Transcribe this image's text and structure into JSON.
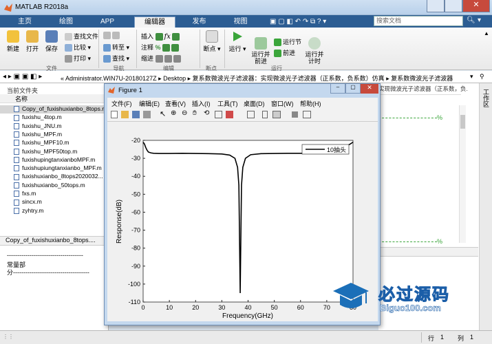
{
  "window": {
    "title": "MATLAB R2018a"
  },
  "tabs": [
    "主页",
    "绘图",
    "APP",
    "编辑器",
    "发布",
    "视图"
  ],
  "search_placeholder": "搜索文档",
  "ribbon": {
    "file": {
      "new": "新建",
      "open": "打开",
      "save": "保存",
      "find_files": "查找文件",
      "compare": "比较",
      "print": "打印",
      "group": "文件"
    },
    "nav": {
      "goto": "转至",
      "find": "查找",
      "group": "导航"
    },
    "edit": {
      "insert": "插入",
      "comment": "注释",
      "indent": "缩进",
      "group": "编辑"
    },
    "breakpoints": {
      "label": "断点",
      "group": "断点"
    },
    "run": {
      "run": "运行",
      "run_advance": "运行并\n前进",
      "run_section": "运行节",
      "advance": "前进",
      "run_time": "运行并\n计时",
      "group": "运行"
    }
  },
  "address": {
    "path": [
      "Administrator.WIN7U-20180127Z",
      "Desktop",
      "复系数微波光子滤波器：实现微波光子滤波器（正系数，负系数）仿真",
      "复系数微波光子滤波器"
    ]
  },
  "current_folder": {
    "title": "当前文件夹",
    "column": "名称",
    "files": [
      "Copy_of_fuxishuxianbo_8tops.m",
      "fuxishu_4top.m",
      "fuxishu_JNU.m",
      "fuxishu_MPF.m",
      "fuxishu_MPF10.m",
      "fuxishu_MPF50top.m",
      "fuxishupingtanxianboMPF.m",
      "fuxishupiungtanxianbo_MPF.m",
      "fuxishuxianbo_8tops2020032...",
      "fuxishuxianbo_50tops.m",
      "fxs.m",
      "sincx.m",
      "zyhtry.m"
    ],
    "details_title": "Copy_of_fuxishuxianbo_8tops....",
    "details_lines": [
      "-------------------------------------",
      "常量部",
      "分-------------------------------------"
    ]
  },
  "editor_right": {
    "header": "实现微波光子滤波器（正系数，负...",
    "marker": "%"
  },
  "side_tab": "工作区",
  "figure": {
    "title": "Figure 1",
    "menu": [
      "文件(F)",
      "编辑(E)",
      "查看(V)",
      "插入(I)",
      "工具(T)",
      "桌面(D)",
      "窗口(W)",
      "帮助(H)"
    ]
  },
  "chart_data": {
    "type": "line",
    "xlabel": "Frequency(GHz)",
    "ylabel": "Response(dB)",
    "xlim": [
      0,
      80
    ],
    "ylim": [
      -110,
      -20
    ],
    "xticks": [
      0,
      10,
      20,
      30,
      40,
      50,
      60,
      70,
      80
    ],
    "yticks": [
      -20,
      -30,
      -40,
      -50,
      -60,
      -70,
      -80,
      -90,
      -100,
      -110
    ],
    "series": [
      {
        "name": "10抽头",
        "color": "#000000",
        "x": [
          0,
          0.5,
          1,
          1.5,
          2,
          3,
          4,
          6,
          10,
          15,
          20,
          25,
          30,
          33,
          35,
          36,
          36.5,
          37,
          37.5,
          38,
          39,
          41,
          45,
          50,
          55,
          60,
          65,
          70,
          75,
          79,
          80
        ],
        "y": [
          -21,
          -22,
          -24,
          -25.5,
          -26.5,
          -27,
          -27.2,
          -27.3,
          -27.3,
          -27.2,
          -27.3,
          -27.4,
          -27.6,
          -28.2,
          -30,
          -35,
          -45,
          -105,
          -45,
          -35,
          -30,
          -28,
          -27.4,
          -27.3,
          -27.2,
          -27.2,
          -27.1,
          -26.5,
          -25,
          -22,
          -21
        ]
      }
    ],
    "legend": "top-right",
    "grid": false
  },
  "status": {
    "row_label": "行",
    "row": "1",
    "col_label": "列",
    "col": "1"
  },
  "watermark": {
    "title": "必过源码",
    "subtitle": "Biguo100.com"
  }
}
